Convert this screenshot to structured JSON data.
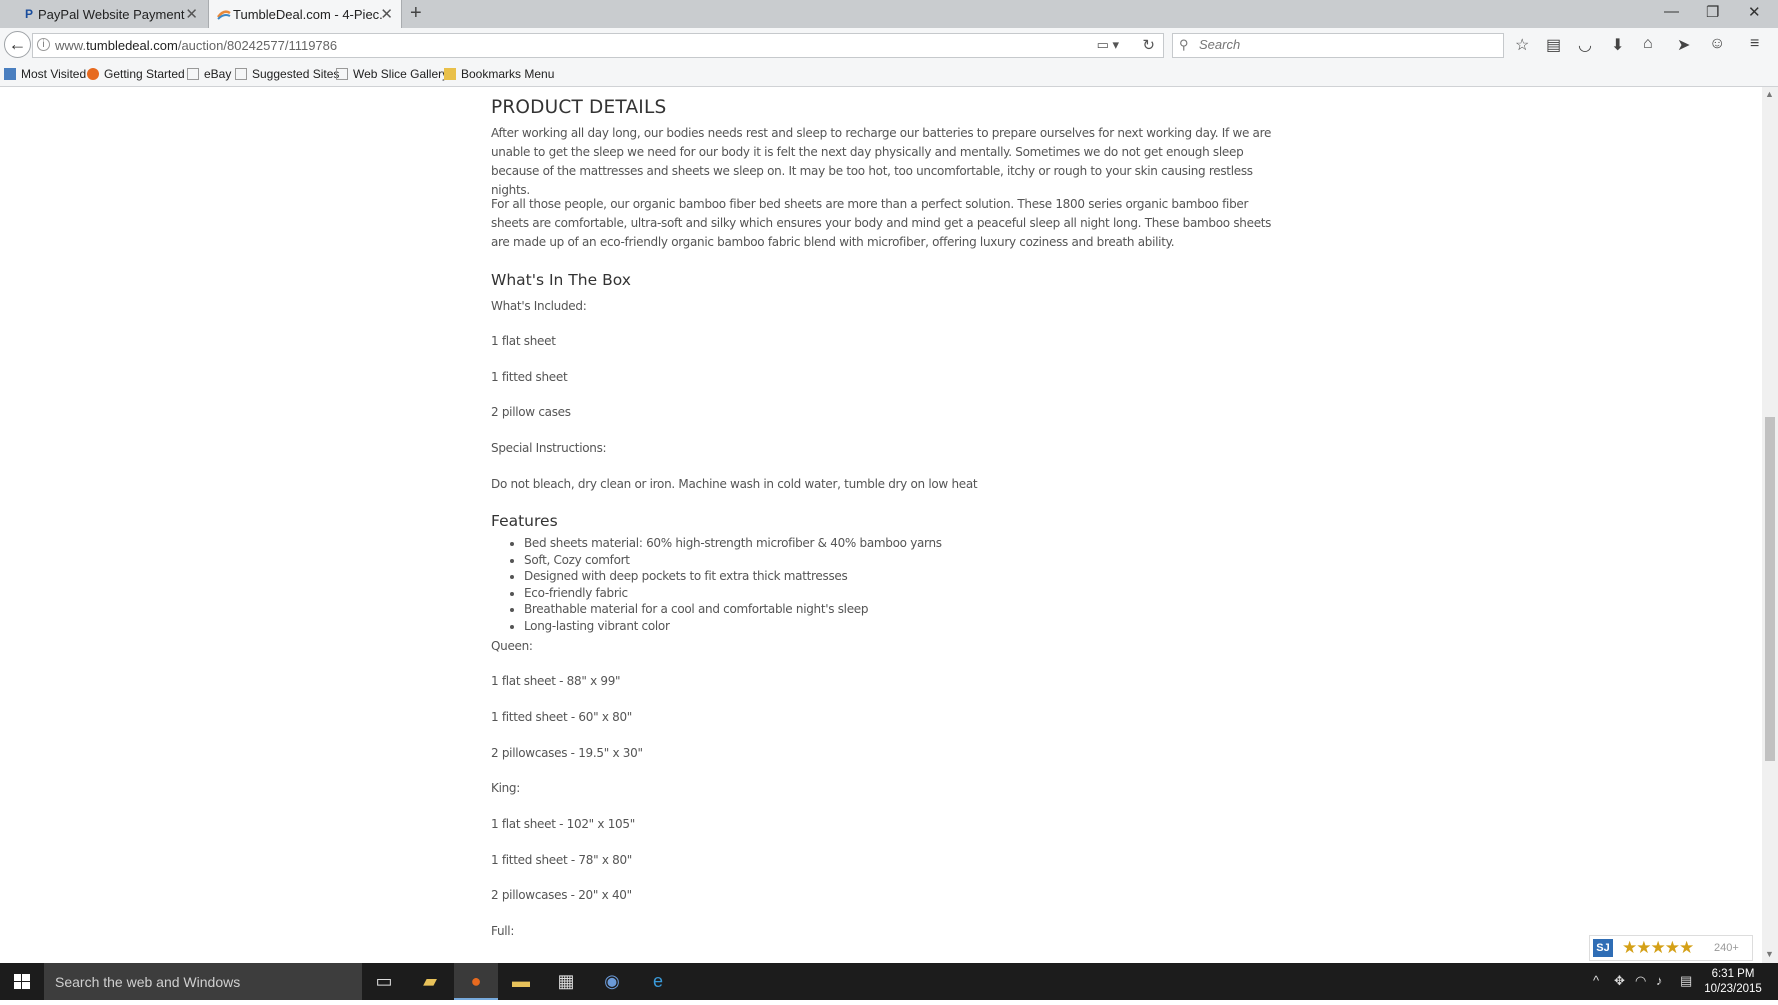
{
  "tabs": [
    {
      "title": "PayPal Website Payment ...",
      "favicon": "paypal-icon",
      "active": false
    },
    {
      "title": "TumbleDeal.com - 4-Piec...",
      "favicon": "tumbledeal-icon",
      "active": true
    }
  ],
  "toolbar": {
    "url_prefix": "www.",
    "url_host": "tumbledeal.com",
    "url_path": "/auction/80242577/1119786",
    "search_placeholder": "Search"
  },
  "bookmarks": [
    {
      "label": "Most Visited",
      "icon": "most-visited-icon"
    },
    {
      "label": "Getting Started",
      "icon": "firefox-icon"
    },
    {
      "label": "eBay",
      "icon": "page-icon"
    },
    {
      "label": "Suggested Sites",
      "icon": "page-icon"
    },
    {
      "label": "Web Slice Gallery",
      "icon": "page-icon"
    },
    {
      "label": "Bookmarks Menu",
      "icon": "folder-icon"
    }
  ],
  "article": {
    "heading": "PRODUCT DETAILS",
    "para1": "After working all day long, our bodies needs rest and sleep to recharge our batteries to prepare ourselves for next working day. If we are unable to get the sleep we need for our body it is felt the next day physically and mentally. Sometimes we do not get enough sleep because of the mattresses and sheets we sleep on. It may be too hot, too uncomfortable, itchy or rough to your skin causing restless nights.",
    "para2": "For all those people, our organic bamboo fiber bed sheets are more than a perfect solution. These 1800 series organic bamboo fiber sheets are comfortable, ultra-soft and silky which ensures your body and mind get a peaceful sleep all night long. These bamboo sheets are made up of an eco-friendly organic bamboo fabric blend with microfiber, offering luxury coziness and breath ability.",
    "box_heading": "What's In The Box",
    "included_label": "What's Included:",
    "included": [
      "1 flat sheet",
      "1 fitted sheet",
      "2 pillow cases"
    ],
    "special_label": "Special Instructions:",
    "special_text": "Do not bleach, dry clean or iron. Machine wash in cold water, tumble dry on low heat",
    "features_heading": "Features",
    "features": [
      "Bed sheets material: 60% high-strength microfiber & 40% bamboo yarns",
      "Soft, Cozy comfort",
      "Designed with deep pockets to fit extra thick mattresses",
      "Eco-friendly fabric",
      "Breathable material for a cool and comfortable night's sleep",
      "Long-lasting vibrant color"
    ],
    "queen_label": "Queen:",
    "queen": [
      "1 flat sheet - 88\" x 99\"",
      "1 fitted sheet - 60\" x 80\"",
      "2 pillowcases - 19.5\" x 30\""
    ],
    "king_label": "King:",
    "king": [
      "1 flat sheet - 102\" x 105\"",
      "1 fitted sheet - 78\" x 80\"",
      "2 pillowcases - 20\" x 40\""
    ],
    "full_label": "Full:"
  },
  "rating_widget": {
    "badge": "SJ",
    "stars": "★★★★★",
    "count": "240+"
  },
  "taskbar": {
    "search_placeholder": "Search the web and Windows",
    "time": "6:31 PM",
    "date": "10/23/2015"
  }
}
